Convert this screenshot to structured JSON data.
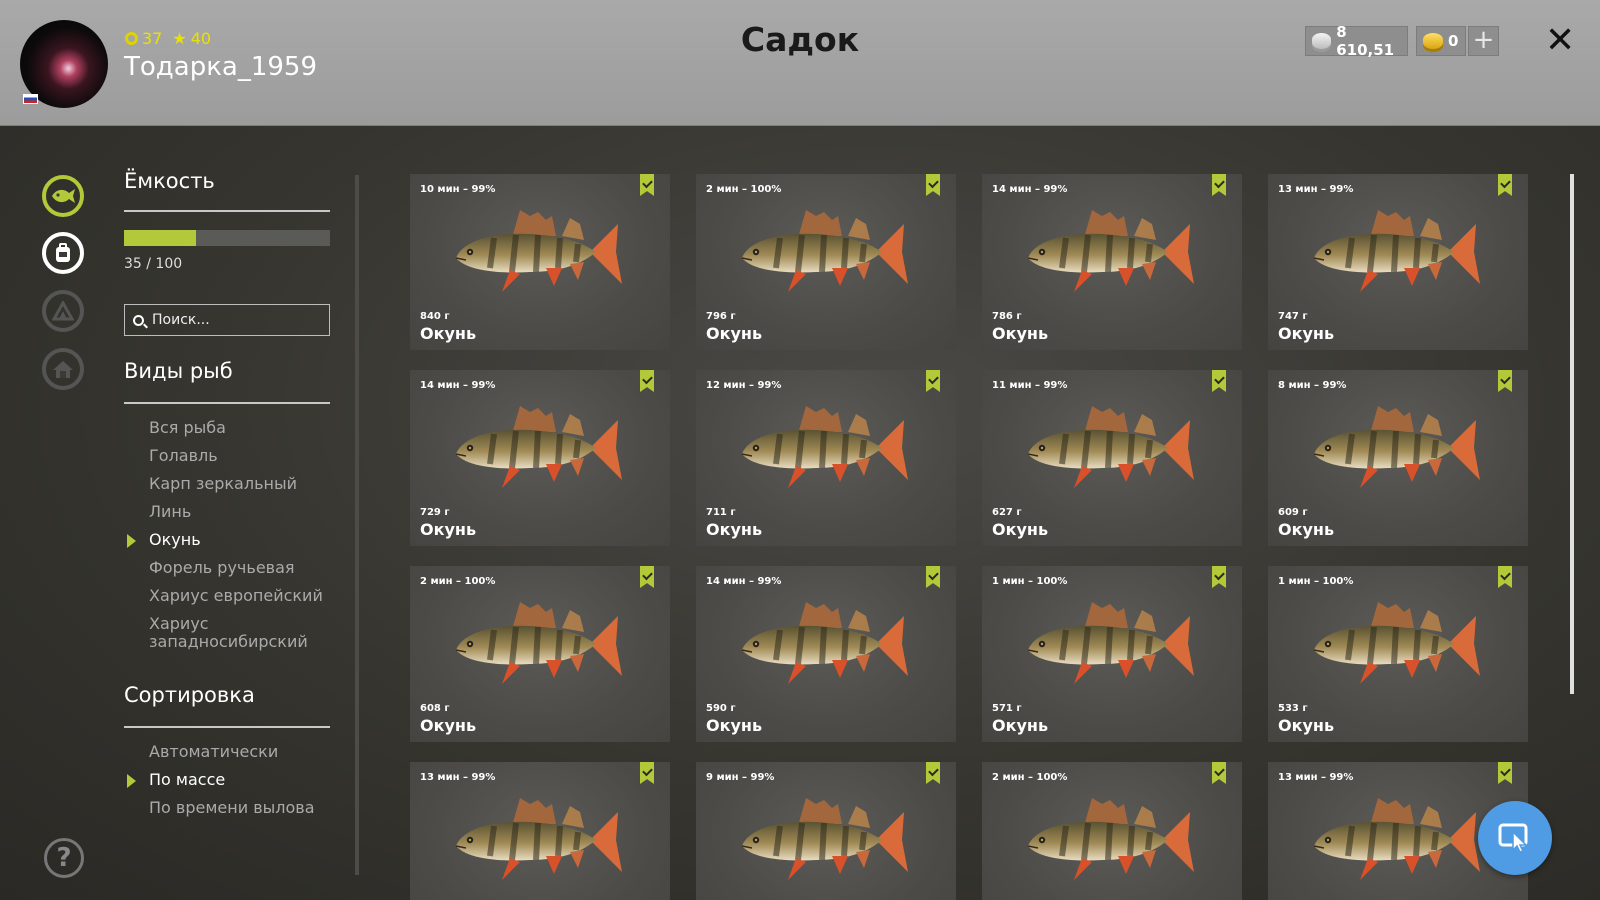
{
  "header": {
    "title": "Садок",
    "username": "Тодарка_1959",
    "level": "37",
    "rank": "40",
    "silver": "8 610,51",
    "gold": "0",
    "plus": "+",
    "close": "✕"
  },
  "sidebar": {
    "capacity_title": "Ёмкость",
    "capacity_value": 35,
    "capacity_max": 100,
    "capacity_text": "35 / 100",
    "search_placeholder": "Поиск...",
    "species_title": "Виды рыб",
    "species": [
      {
        "label": "Вся рыба",
        "active": false
      },
      {
        "label": "Голавль",
        "active": false
      },
      {
        "label": "Карп зеркальный",
        "active": false
      },
      {
        "label": "Линь",
        "active": false
      },
      {
        "label": "Окунь",
        "active": true
      },
      {
        "label": "Форель ручьевая",
        "active": false
      },
      {
        "label": "Хариус европейский",
        "active": false
      },
      {
        "label": "Хариус западносибирский",
        "active": false
      }
    ],
    "sort_title": "Сортировка",
    "sort": [
      {
        "label": "Автоматически",
        "active": false
      },
      {
        "label": "По массе",
        "active": true
      },
      {
        "label": "По времени вылова",
        "active": false
      }
    ],
    "help": "?"
  },
  "fish": [
    {
      "time": "10 мин – 99%",
      "weight": "840 г",
      "name": "Окунь"
    },
    {
      "time": "2 мин – 100%",
      "weight": "796 г",
      "name": "Окунь"
    },
    {
      "time": "14 мин – 99%",
      "weight": "786 г",
      "name": "Окунь"
    },
    {
      "time": "13 мин – 99%",
      "weight": "747 г",
      "name": "Окунь"
    },
    {
      "time": "14 мин – 99%",
      "weight": "729 г",
      "name": "Окунь"
    },
    {
      "time": "12 мин – 99%",
      "weight": "711 г",
      "name": "Окунь"
    },
    {
      "time": "11 мин – 99%",
      "weight": "627 г",
      "name": "Окунь"
    },
    {
      "time": "8 мин – 99%",
      "weight": "609 г",
      "name": "Окунь"
    },
    {
      "time": "2 мин – 100%",
      "weight": "608 г",
      "name": "Окунь"
    },
    {
      "time": "14 мин – 99%",
      "weight": "590 г",
      "name": "Окунь"
    },
    {
      "time": "1 мин – 100%",
      "weight": "571 г",
      "name": "Окунь"
    },
    {
      "time": "1 мин – 100%",
      "weight": "533 г",
      "name": "Окунь"
    },
    {
      "time": "13 мин – 99%",
      "weight": "",
      "name": ""
    },
    {
      "time": "9 мин – 99%",
      "weight": "",
      "name": ""
    },
    {
      "time": "2 мин – 100%",
      "weight": "",
      "name": ""
    },
    {
      "time": "13 мин – 99%",
      "weight": "",
      "name": ""
    }
  ],
  "colors": {
    "accent": "#b4c93a",
    "fab": "#4f9be4"
  }
}
